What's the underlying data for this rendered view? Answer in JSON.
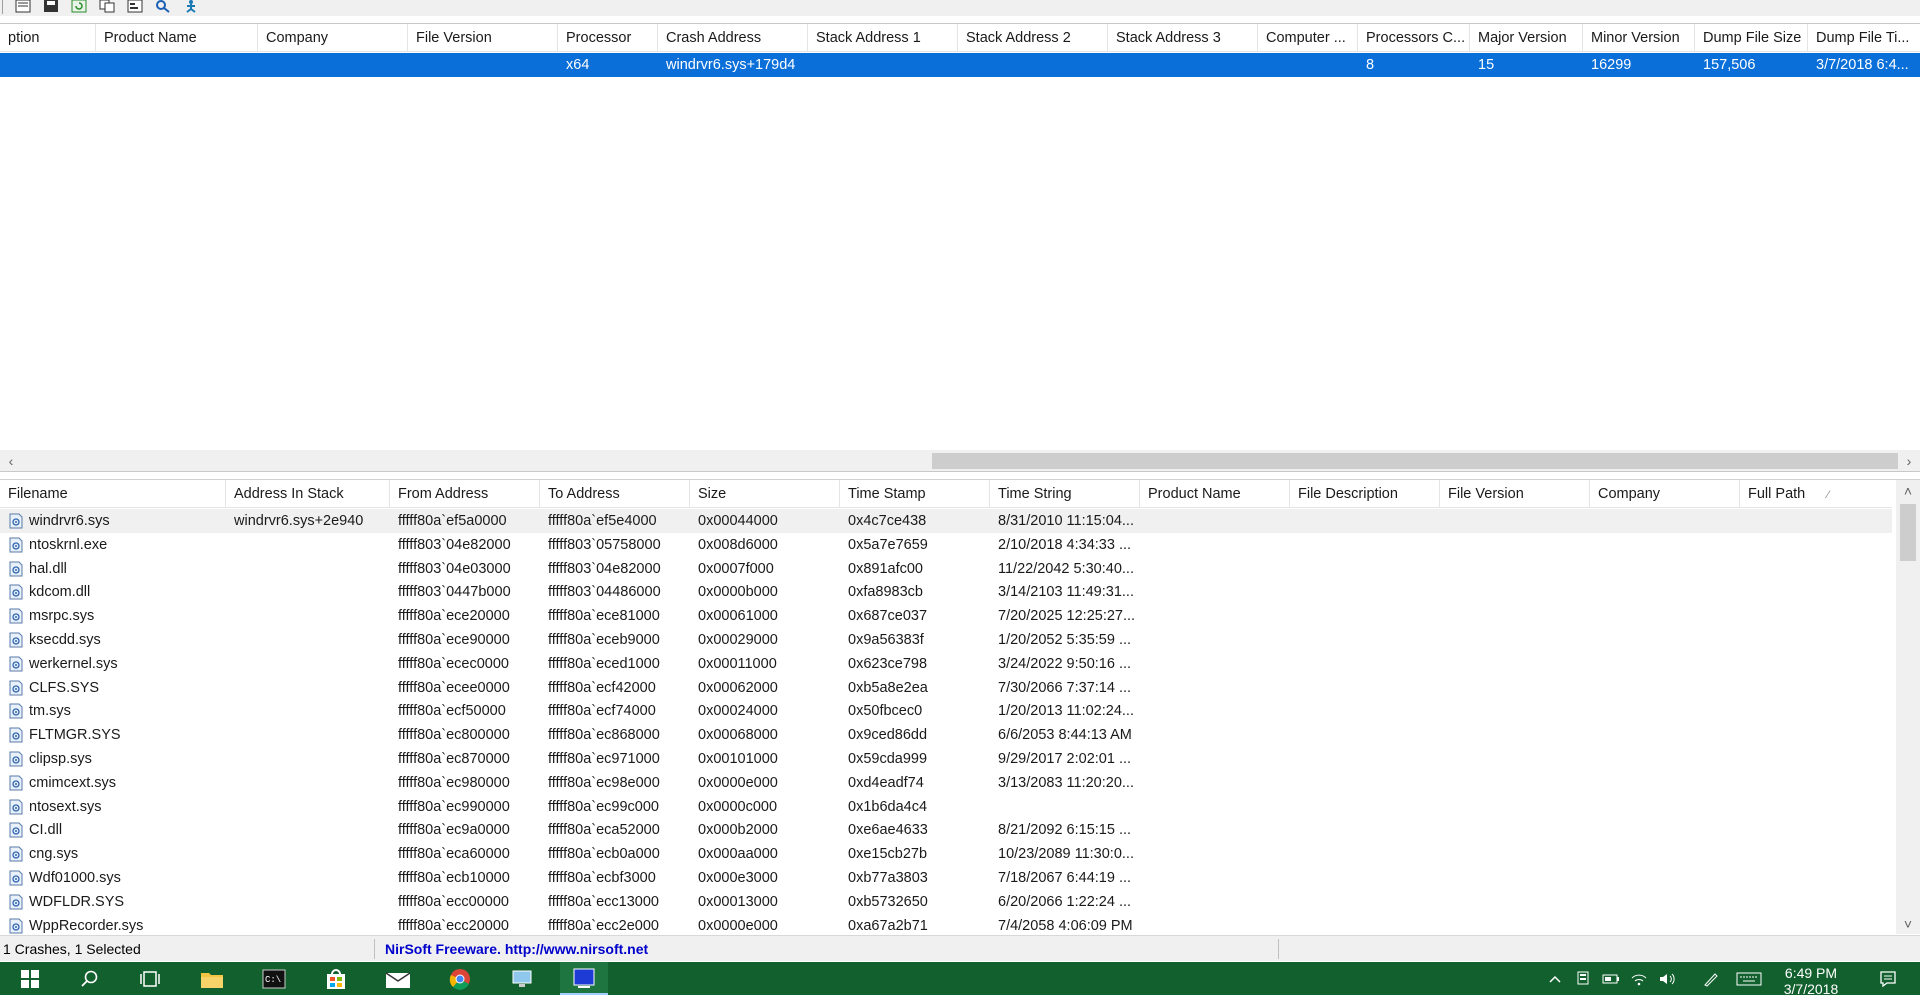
{
  "upper": {
    "columns": [
      {
        "label": "ption"
      },
      {
        "label": "Product Name"
      },
      {
        "label": "Company"
      },
      {
        "label": "File Version"
      },
      {
        "label": "Processor"
      },
      {
        "label": "Crash Address"
      },
      {
        "label": "Stack Address 1"
      },
      {
        "label": "Stack Address 2"
      },
      {
        "label": "Stack Address 3"
      },
      {
        "label": "Computer ..."
      },
      {
        "label": "Processors C..."
      },
      {
        "label": "Major Version"
      },
      {
        "label": "Minor Version"
      },
      {
        "label": "Dump File Size"
      },
      {
        "label": "Dump File Ti..."
      }
    ],
    "selected_row": {
      "processor": "x64",
      "crash_address": "windrvr6.sys+179d4",
      "processors_count": "8",
      "major_version": "15",
      "minor_version": "16299",
      "dump_file_size": "157,506",
      "dump_file_time": "3/7/2018 6:4..."
    }
  },
  "lower": {
    "columns": [
      {
        "label": "Filename"
      },
      {
        "label": "Address In Stack"
      },
      {
        "label": "From Address"
      },
      {
        "label": "To Address"
      },
      {
        "label": "Size"
      },
      {
        "label": "Time Stamp"
      },
      {
        "label": "Time String"
      },
      {
        "label": "Product Name"
      },
      {
        "label": "File Description"
      },
      {
        "label": "File Version"
      },
      {
        "label": "Company"
      },
      {
        "label": "Full Path"
      }
    ],
    "sort_indicator": "⁄",
    "rows": [
      {
        "filename": "windrvr6.sys",
        "address_in_stack": "windrvr6.sys+2e940",
        "from": "fffff80a`ef5a0000",
        "to": "fffff80a`ef5e4000",
        "size": "0x00044000",
        "timestamp": "0x4c7ce438",
        "timestring": "8/31/2010 11:15:04..."
      },
      {
        "filename": "ntoskrnl.exe",
        "address_in_stack": "",
        "from": "fffff803`04e82000",
        "to": "fffff803`05758000",
        "size": "0x008d6000",
        "timestamp": "0x5a7e7659",
        "timestring": "2/10/2018 4:34:33 ..."
      },
      {
        "filename": "hal.dll",
        "address_in_stack": "",
        "from": "fffff803`04e03000",
        "to": "fffff803`04e82000",
        "size": "0x0007f000",
        "timestamp": "0x891afc00",
        "timestring": "11/22/2042 5:30:40..."
      },
      {
        "filename": "kdcom.dll",
        "address_in_stack": "",
        "from": "fffff803`0447b000",
        "to": "fffff803`04486000",
        "size": "0x0000b000",
        "timestamp": "0xfa8983cb",
        "timestring": "3/14/2103 11:49:31..."
      },
      {
        "filename": "msrpc.sys",
        "address_in_stack": "",
        "from": "fffff80a`ece20000",
        "to": "fffff80a`ece81000",
        "size": "0x00061000",
        "timestamp": "0x687ce037",
        "timestring": "7/20/2025 12:25:27..."
      },
      {
        "filename": "ksecdd.sys",
        "address_in_stack": "",
        "from": "fffff80a`ece90000",
        "to": "fffff80a`eceb9000",
        "size": "0x00029000",
        "timestamp": "0x9a56383f",
        "timestring": "1/20/2052 5:35:59 ..."
      },
      {
        "filename": "werkernel.sys",
        "address_in_stack": "",
        "from": "fffff80a`ecec0000",
        "to": "fffff80a`eced1000",
        "size": "0x00011000",
        "timestamp": "0x623ce798",
        "timestring": "3/24/2022 9:50:16 ..."
      },
      {
        "filename": "CLFS.SYS",
        "address_in_stack": "",
        "from": "fffff80a`ecee0000",
        "to": "fffff80a`ecf42000",
        "size": "0x00062000",
        "timestamp": "0xb5a8e2ea",
        "timestring": "7/30/2066 7:37:14 ..."
      },
      {
        "filename": "tm.sys",
        "address_in_stack": "",
        "from": "fffff80a`ecf50000",
        "to": "fffff80a`ecf74000",
        "size": "0x00024000",
        "timestamp": "0x50fbcec0",
        "timestring": "1/20/2013 11:02:24..."
      },
      {
        "filename": "FLTMGR.SYS",
        "address_in_stack": "",
        "from": "fffff80a`ec800000",
        "to": "fffff80a`ec868000",
        "size": "0x00068000",
        "timestamp": "0x9ced86dd",
        "timestring": "6/6/2053 8:44:13 AM"
      },
      {
        "filename": "clipsp.sys",
        "address_in_stack": "",
        "from": "fffff80a`ec870000",
        "to": "fffff80a`ec971000",
        "size": "0x00101000",
        "timestamp": "0x59cda999",
        "timestring": "9/29/2017 2:02:01 ..."
      },
      {
        "filename": "cmimcext.sys",
        "address_in_stack": "",
        "from": "fffff80a`ec980000",
        "to": "fffff80a`ec98e000",
        "size": "0x0000e000",
        "timestamp": "0xd4eadf74",
        "timestring": "3/13/2083 11:20:20..."
      },
      {
        "filename": "ntosext.sys",
        "address_in_stack": "",
        "from": "fffff80a`ec990000",
        "to": "fffff80a`ec99c000",
        "size": "0x0000c000",
        "timestamp": "0x1b6da4c4",
        "timestring": ""
      },
      {
        "filename": "CI.dll",
        "address_in_stack": "",
        "from": "fffff80a`ec9a0000",
        "to": "fffff80a`eca52000",
        "size": "0x000b2000",
        "timestamp": "0xe6ae4633",
        "timestring": "8/21/2092 6:15:15 ..."
      },
      {
        "filename": "cng.sys",
        "address_in_stack": "",
        "from": "fffff80a`eca60000",
        "to": "fffff80a`ecb0a000",
        "size": "0x000aa000",
        "timestamp": "0xe15cb27b",
        "timestring": "10/23/2089 11:30:0..."
      },
      {
        "filename": "Wdf01000.sys",
        "address_in_stack": "",
        "from": "fffff80a`ecb10000",
        "to": "fffff80a`ecbf3000",
        "size": "0x000e3000",
        "timestamp": "0xb77a3803",
        "timestring": "7/18/2067 6:44:19 ..."
      },
      {
        "filename": "WDFLDR.SYS",
        "address_in_stack": "",
        "from": "fffff80a`ecc00000",
        "to": "fffff80a`ecc13000",
        "size": "0x00013000",
        "timestamp": "0xb5732650",
        "timestring": "6/20/2066 1:22:24 ..."
      },
      {
        "filename": "WppRecorder.sys",
        "address_in_stack": "",
        "from": "fffff80a`ecc20000",
        "to": "fffff80a`ecc2e000",
        "size": "0x0000e000",
        "timestamp": "0xa67a2b71",
        "timestring": "7/4/2058 4:06:09 PM"
      }
    ]
  },
  "status": {
    "crashes": "1 Crashes, 1 Selected",
    "nirsoft": "NirSoft Freeware.  http://www.nirsoft.net"
  },
  "taskbar": {
    "time": "6:49 PM",
    "date": "3/7/2018"
  },
  "colors": {
    "selection": "#0a6fd8",
    "taskbar": "#12602e",
    "link": "#0000cc"
  }
}
